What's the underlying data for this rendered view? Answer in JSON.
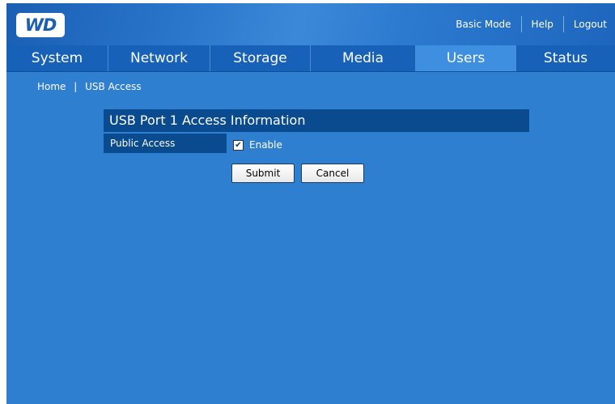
{
  "header": {
    "logo_text": "WD",
    "links": {
      "basic_mode": "Basic Mode",
      "help": "Help",
      "logout": "Logout"
    }
  },
  "nav": {
    "tabs": [
      "System",
      "Network",
      "Storage",
      "Media",
      "Users",
      "Status"
    ],
    "active": "Users"
  },
  "breadcrumb": {
    "home": "Home",
    "separator": "|",
    "current": "USB Access"
  },
  "panel": {
    "title": "USB Port 1 Access Information",
    "public_access_label": "Public Access",
    "enable_label": "Enable",
    "enable_checked": true,
    "checkmark": "✔"
  },
  "buttons": {
    "submit": "Submit",
    "cancel": "Cancel"
  },
  "colors": {
    "background": "#2f7fd0",
    "nav": "#1762b8",
    "active_tab": "#3e8fe0",
    "panel_header": "#0a4a8e"
  }
}
